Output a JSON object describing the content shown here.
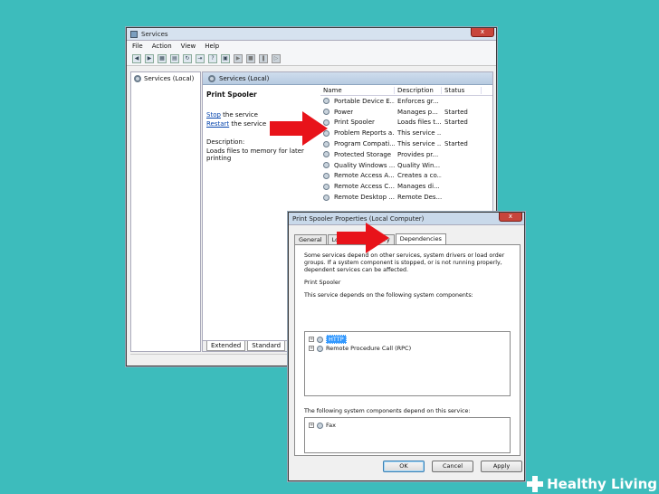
{
  "services_window": {
    "title": "Services",
    "close_label": "x",
    "menu": [
      "File",
      "Action",
      "View",
      "Help"
    ],
    "tree_item": "Services (Local)",
    "pane_header": "Services (Local)",
    "selected_service": "Print Spooler",
    "stop_link": "Stop",
    "stop_rest": " the service",
    "restart_link": "Restart",
    "restart_rest": " the service",
    "description_label": "Description:",
    "description_text": "Loads files to memory for later printing",
    "columns": [
      "Name",
      "Description",
      "Status"
    ],
    "rows": [
      {
        "name": "Portable Device E...",
        "desc": "Enforces gr...",
        "status": ""
      },
      {
        "name": "Power",
        "desc": "Manages p...",
        "status": "Started"
      },
      {
        "name": "Print Spooler",
        "desc": "Loads files t...",
        "status": "Started"
      },
      {
        "name": "Problem Reports a...",
        "desc": "This service ...",
        "status": ""
      },
      {
        "name": "Program Compati...",
        "desc": "This service ...",
        "status": "Started"
      },
      {
        "name": "Protected Storage",
        "desc": "Provides pr...",
        "status": ""
      },
      {
        "name": "Quality Windows ...",
        "desc": "Quality Win...",
        "status": ""
      },
      {
        "name": "Remote Access A...",
        "desc": "Creates a co...",
        "status": ""
      },
      {
        "name": "Remote Access C...",
        "desc": "Manages di...",
        "status": ""
      },
      {
        "name": "Remote Desktop ...",
        "desc": "Remote Des...",
        "status": ""
      }
    ],
    "tab_extended": "Extended",
    "tab_standard": "Standard"
  },
  "dialog": {
    "title": "Print Spooler Properties (Local Computer)",
    "close_label": "x",
    "tabs": [
      "General",
      "Log On",
      "Recovery",
      "Dependencies"
    ],
    "intro": "Some services depend on other services, system drivers or load order groups. If a system component is stopped, or is not running properly, dependent services can be affected.",
    "service_name": "Print Spooler",
    "depends_on_label": "This service depends on the following system components:",
    "depends_on": [
      "HTTP",
      "Remote Procedure Call (RPC)"
    ],
    "dependents_label": "The following system components depend on this service:",
    "dependents": [
      "Fax"
    ],
    "ok": "OK",
    "cancel": "Cancel",
    "apply": "Apply"
  },
  "watermark": {
    "text": "Healthy Living"
  },
  "colors": {
    "background": "#3dbcbc",
    "arrow": "#e8131a",
    "selection": "#3399ff"
  }
}
